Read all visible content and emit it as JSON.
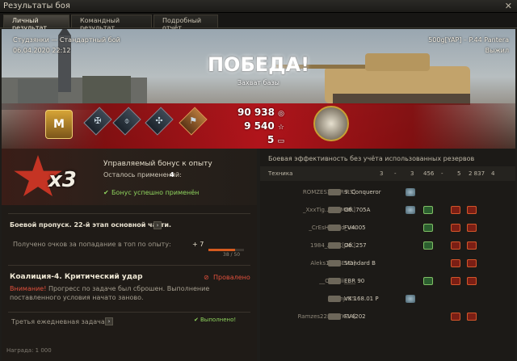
{
  "window": {
    "title": "Результаты боя",
    "close_icon": "close-icon"
  },
  "tabs": [
    {
      "label": "Личный результат",
      "active": true
    },
    {
      "label": "Командный результат",
      "active": false
    },
    {
      "label": "Подробный отчёт",
      "active": false
    }
  ],
  "hero": {
    "map_mode": "Студзянки — Стандартный бой",
    "datetime": "06.04.2020 22:12",
    "player_vehicle": "500g[YAP] – P.44 Pantera",
    "status": "Выжил",
    "result": "ПОБЕДА!",
    "reason": "Захват базы"
  },
  "awards": {
    "mastery": "M",
    "medals": [
      "medal-1",
      "medal-2",
      "medal-3",
      "medal-4"
    ]
  },
  "totals": {
    "credits": "90 938",
    "xp": "9 540",
    "bonds": "5"
  },
  "bonus": {
    "multiplier": "x3",
    "title": "Управляемый бонус к опыту",
    "remaining_label": "Осталось применений:",
    "remaining_value": "4",
    "applied": "Бонус успешно применён"
  },
  "battlepass": {
    "title": "Боевой пропуск. 22-й этап основной части.",
    "points_label": "Получено очков за попадание в топ по опыту:",
    "points_delta": "+ 7",
    "progress_text": "38 / 50",
    "progress": 0.76
  },
  "mission": {
    "title": "Коалиция-4. Критический удар",
    "status": "Провалено",
    "warning": "Внимание!",
    "text": "Прогресс по задаче был сброшен. Выполнение поставленного условия начато заново."
  },
  "daily": {
    "title": "Третья ежедневная задача",
    "status": "Выполнено!",
    "reward": "Награда: 1 000"
  },
  "efficiency": {
    "header": "Боевая эффективность без учёта использованных резервов",
    "columns": [
      "Техника",
      "3",
      "-",
      "3",
      "456",
      "-",
      "5",
      "2 837",
      "4"
    ],
    "rows": [
      {
        "player": "ROMZES1...[IR-RS]",
        "tank": "S. Conqueror",
        "icons": [
          "b"
        ]
      },
      {
        "player": "_XxxTig...[BOMBR]",
        "tank": "Об. 705А",
        "icons": [
          "b",
          "g",
          "r",
          "o",
          "r"
        ]
      },
      {
        "player": "_CrEsH_Gold_UA",
        "tank": "FV4005",
        "icons": [
          "g",
          "r",
          "o",
          "r"
        ]
      },
      {
        "player": "1984_ALEX[JAK]",
        "tank": "Об. 257",
        "icons": [
          "g",
          "r",
          "o",
          "r"
        ]
      },
      {
        "player": "Aleks13_[SEVD]",
        "tank": "Standard B",
        "icons": [
          "r",
          "o",
          "r"
        ]
      },
      {
        "player": "__Omitrii____",
        "tank": "EBR 90",
        "icons": [
          "g",
          "r",
          "o",
          "r"
        ]
      },
      {
        "player": "smyr35",
        "tank": "VK 168.01 P",
        "icons": [
          "b"
        ]
      },
      {
        "player": "Ramzes228...[YKZA]",
        "tank": "FV4202",
        "icons": [
          "r",
          "o",
          "r"
        ]
      }
    ]
  }
}
